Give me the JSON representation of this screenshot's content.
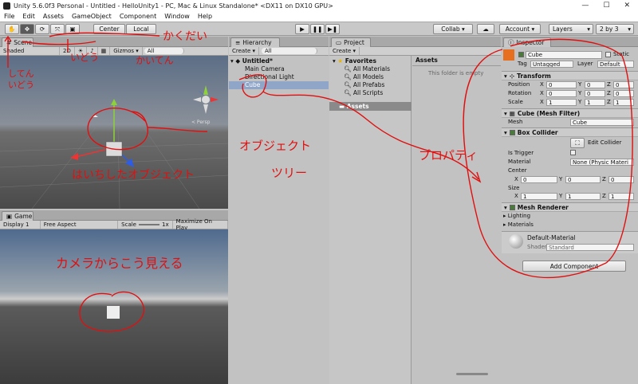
{
  "window": {
    "title": "Unity 5.6.0f3 Personal - Untitled - HelloUnity1 - PC, Mac & Linux Standalone* <DX11 on DX10 GPU>"
  },
  "menu": [
    "File",
    "Edit",
    "Assets",
    "GameObject",
    "Component",
    "Window",
    "Help"
  ],
  "toolbar": {
    "center": "Center",
    "local": "Local",
    "collab": "Collab ▾",
    "account": "Account ▾",
    "layers": "Layers",
    "layout": "2 by 3"
  },
  "scene": {
    "tab": "Scene",
    "shaded": "Shaded",
    "mode2d": "2D",
    "gizmos": "Gizmos ▾",
    "search_placeholder": "All",
    "persp": "< Persp"
  },
  "game": {
    "tab": "Game",
    "display": "Display 1",
    "aspect": "Free Aspect",
    "scale_label": "Scale",
    "scale_value": "1x",
    "maximize": "Maximize On Play"
  },
  "hierarchy": {
    "tab": "Hierarchy",
    "create": "Create ▾",
    "search_placeholder": "All",
    "scene_name": "Untitled*",
    "items": [
      "Main Camera",
      "Directional Light",
      "Cube"
    ]
  },
  "project": {
    "tab": "Project",
    "create": "Create ▾",
    "favorites": "Favorites",
    "fav_items": [
      "All Materials",
      "All Models",
      "All Prefabs",
      "All Scripts"
    ],
    "assets": "Assets",
    "assets_header": "Assets",
    "empty": "This folder is empty"
  },
  "inspector": {
    "tab": "Inspector",
    "object_name": "Cube",
    "static_label": "Static",
    "tag_label": "Tag",
    "tag_value": "Untagged",
    "layer_label": "Layer",
    "layer_value": "Default",
    "transform": {
      "title": "Transform",
      "position_label": "Position",
      "rotation_label": "Rotation",
      "scale_label": "Scale",
      "position": [
        "0",
        "0",
        "0"
      ],
      "rotation": [
        "0",
        "0",
        "0"
      ],
      "scale": [
        "1",
        "1",
        "1"
      ]
    },
    "mesh_filter": {
      "title": "Cube (Mesh Filter)",
      "mesh_label": "Mesh",
      "mesh_value": "Cube"
    },
    "box_collider": {
      "title": "Box Collider",
      "edit_label": "Edit Collider",
      "is_trigger": "Is Trigger",
      "material_label": "Material",
      "material_value": "None (Physic Materi",
      "center_label": "Center",
      "center": [
        "0",
        "0",
        "0"
      ],
      "size_label": "Size",
      "size": [
        "1",
        "1",
        "1"
      ]
    },
    "mesh_renderer": {
      "title": "Mesh Renderer",
      "lighting": "Lighting",
      "materials": "Materials"
    },
    "material": {
      "name": "Default-Material",
      "shader_label": "Shader",
      "shader_value": "Standard"
    },
    "add_component": "Add Component"
  },
  "axes": {
    "x": "X",
    "y": "Y",
    "z": "Z"
  },
  "annotations": {
    "kakudai": "かくだい",
    "idou": "いどう",
    "kaiten": "かいてん",
    "shiten1": "してん",
    "shiten2": "いどう",
    "placed_object": "はいちしたオブジェクト",
    "object": "オブジェクト",
    "tree": "ツリー",
    "property": "プロパティ",
    "camera_view": "カメラからこう見える"
  },
  "colors": {
    "annotation": "#e01010",
    "selection": "#8fa6c8"
  }
}
